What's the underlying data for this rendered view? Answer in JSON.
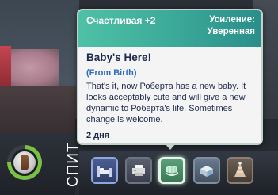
{
  "tooltip": {
    "mood_label": "Счастливая +2",
    "boost_label": "Усиление:",
    "boost_value": "Уверенная",
    "title": "Baby's Here!",
    "source": "(From Birth)",
    "description": "That's it, now Роберта has a new baby. It looks acceptably cute and will give a new dynamic to Роберта's life. Sometimes change is welcome.",
    "duration": "2 дня"
  },
  "needs_panel": {
    "activity_label": "СПИТ",
    "mood_ring_fill": 0.75,
    "mood_ring_color": "#79c142"
  },
  "moodlets": [
    {
      "icon": "bed-icon",
      "selected": false
    },
    {
      "icon": "printer-icon",
      "selected": false
    },
    {
      "icon": "crib-icon",
      "selected": true
    },
    {
      "icon": "baby-blocks-icon",
      "selected": false
    },
    {
      "icon": "party-hat-icon",
      "selected": false
    }
  ],
  "colors": {
    "header_gradient_start": "#4fc1a6",
    "header_gradient_end": "#2a8e8a",
    "title_color": "#1d2a4a",
    "source_color": "#2f6fb8",
    "tooltip_bg": "#f4f4f4"
  }
}
